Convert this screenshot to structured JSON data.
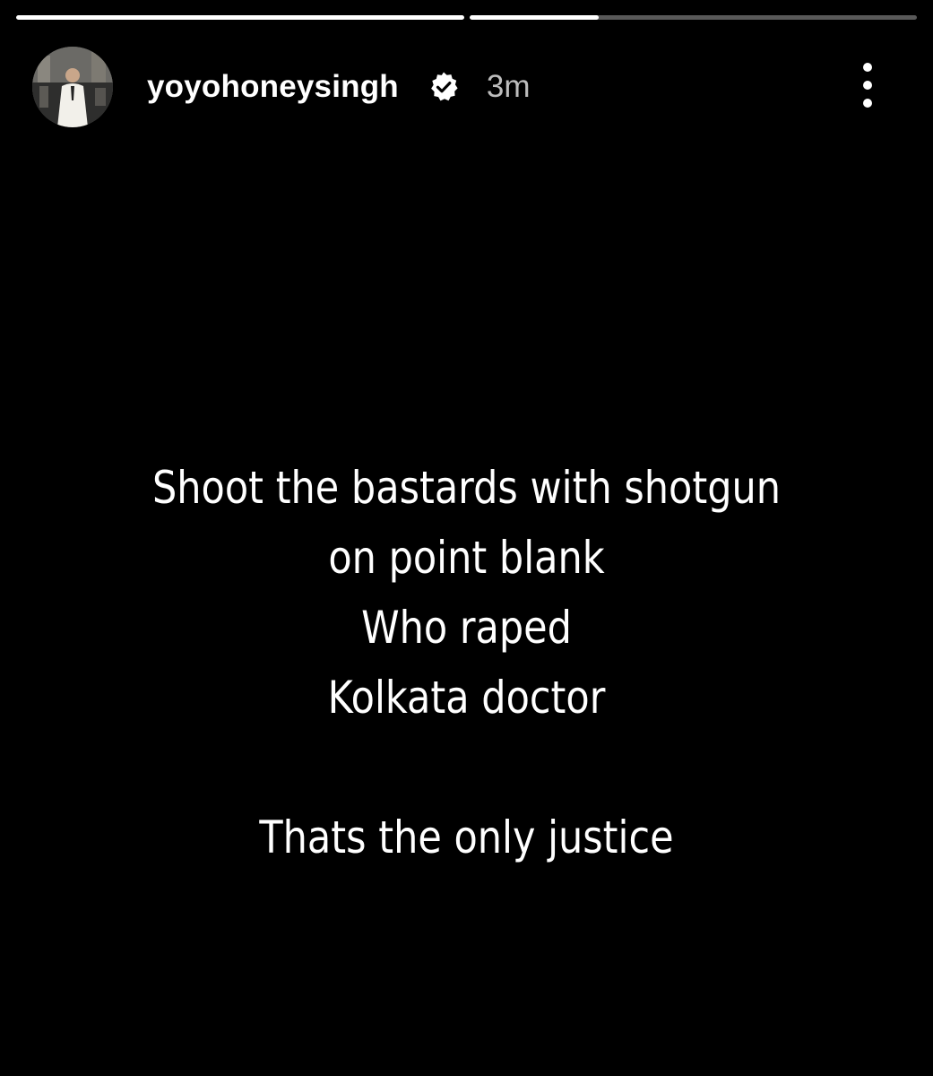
{
  "story": {
    "progress": [
      {
        "fraction": 1.0
      },
      {
        "fraction": 0.29
      }
    ],
    "header": {
      "username": "yoyohoneysingh",
      "verified": true,
      "timestamp": "3m",
      "more_icon": "more-vertical-icon",
      "verified_icon": "verified-badge-icon"
    },
    "lines": [
      "Shoot the bastards with shotgun",
      "on point blank",
      "Who raped",
      "Kolkata doctor",
      "",
      "Thats the only justice"
    ],
    "colors": {
      "background": "#000000",
      "text": "#ffffff",
      "timestamp": "#bdbdbd"
    }
  }
}
